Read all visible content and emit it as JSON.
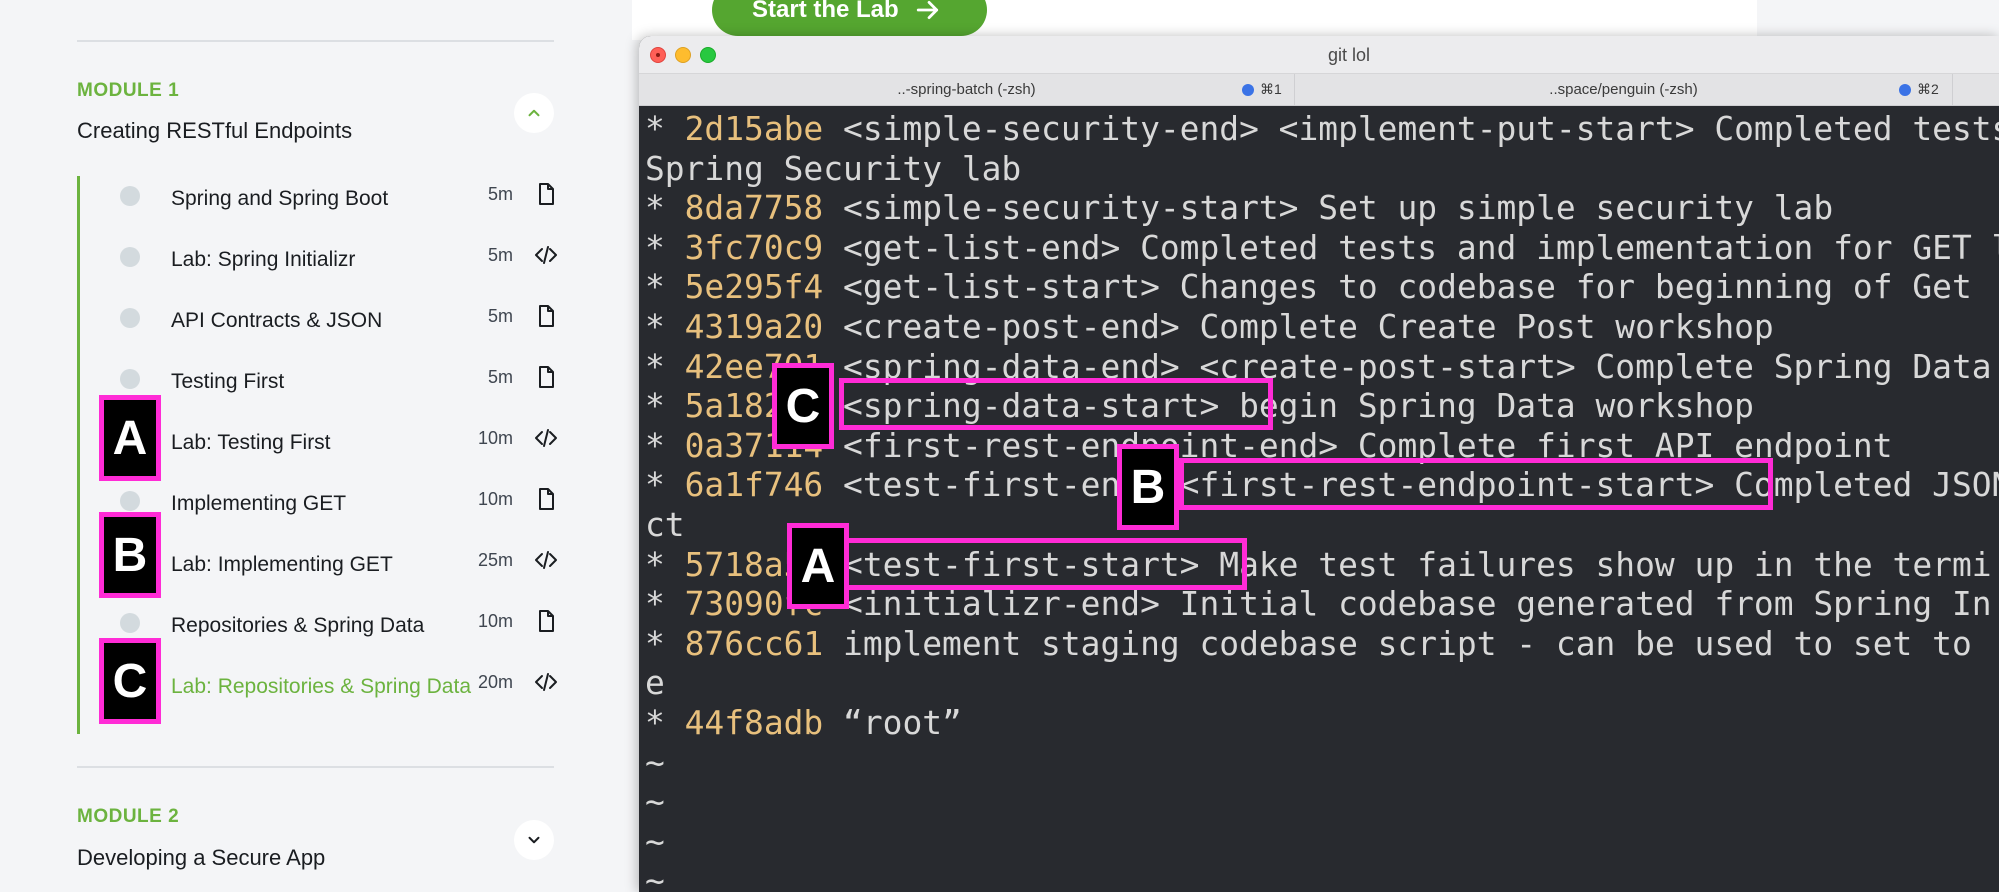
{
  "sidebar": {
    "module1": {
      "label": "MODULE 1",
      "title": "Creating RESTful Endpoints",
      "toggle_icon": "chevron-up-icon"
    },
    "lessons": [
      {
        "name": "Spring and Spring Boot",
        "duration": "5m",
        "icon": "document-icon"
      },
      {
        "name": "Lab: Spring Initializr",
        "duration": "5m",
        "icon": "code-icon"
      },
      {
        "name": "API Contracts & JSON",
        "duration": "5m",
        "icon": "document-icon"
      },
      {
        "name": "Testing First",
        "duration": "5m",
        "icon": "document-icon"
      },
      {
        "name": "Lab: Testing First",
        "duration": "10m",
        "icon": "code-icon"
      },
      {
        "name": "Implementing GET",
        "duration": "10m",
        "icon": "document-icon"
      },
      {
        "name": "Lab: Implementing GET",
        "duration": "25m",
        "icon": "code-icon"
      },
      {
        "name": "Repositories & Spring Data",
        "duration": "10m",
        "icon": "document-icon"
      },
      {
        "name": "Lab: Repositories & Spring Data",
        "duration": "20m",
        "icon": "code-icon"
      }
    ],
    "module2": {
      "label": "MODULE 2",
      "title": "Developing a Secure App",
      "toggle_icon": "chevron-down-icon"
    }
  },
  "page": {
    "start_button": "Start the Lab"
  },
  "terminal": {
    "title": "git lol",
    "tabs": [
      {
        "label": "..-spring-batch (-zsh)",
        "shortcut": "⌘1"
      },
      {
        "label": "..space/penguin (-zsh)",
        "shortcut": "⌘2"
      }
    ],
    "lines": [
      {
        "prefix": "* ",
        "hash": "2d15abe",
        "text": " <simple-security-end> <implement-put-start> Completed tests"
      },
      {
        "prefix": "",
        "hash": "",
        "text": "Spring Security lab"
      },
      {
        "prefix": "* ",
        "hash": "8da7758",
        "text": " <simple-security-start> Set up simple security lab"
      },
      {
        "prefix": "* ",
        "hash": "3fc70c9",
        "text": " <get-list-end> Completed tests and implementation for GET l"
      },
      {
        "prefix": "* ",
        "hash": "5e295f4",
        "text": " <get-list-start> Changes to codebase for beginning of Get"
      },
      {
        "prefix": "* ",
        "hash": "4319a20",
        "text": " <create-post-end> Complete Create Post workshop"
      },
      {
        "prefix": "* ",
        "hash": "42ee701",
        "text": " <spring-data-end> <create-post-start> Complete Spring Data"
      },
      {
        "prefix": "* ",
        "hash": "5a1820c",
        "text": " <spring-data-start> begin Spring Data workshop"
      },
      {
        "prefix": "* ",
        "hash": "0a37114",
        "text": " <first-rest-endpoint-end> Complete first API endpoint"
      },
      {
        "prefix": "* ",
        "hash": "6a1f746",
        "text": " <test-first-end> <first-rest-endpoint-start> Completed JSON"
      },
      {
        "prefix": "",
        "hash": "",
        "text": "ct"
      },
      {
        "prefix": "* ",
        "hash": "5718a5e",
        "text": " <test-first-start> Make test failures show up in the termi"
      },
      {
        "prefix": "* ",
        "hash": "73090fc",
        "text": " <initializr-end> Initial codebase generated from Spring In"
      },
      {
        "prefix": "* ",
        "hash": "876cc61",
        "text": " implement staging codebase script - can be used to set to"
      },
      {
        "prefix": "",
        "hash": "",
        "text": "e"
      },
      {
        "prefix": "* ",
        "hash": "44f8adb",
        "text": " “root”"
      },
      {
        "prefix": "",
        "hash": "",
        "text": "~"
      },
      {
        "prefix": "",
        "hash": "",
        "text": "~"
      },
      {
        "prefix": "",
        "hash": "",
        "text": "~"
      },
      {
        "prefix": "",
        "hash": "",
        "text": "~"
      }
    ]
  },
  "annotations": {
    "a": "A",
    "b": "B",
    "c": "C"
  },
  "colors": {
    "accent_green": "#6cb33f",
    "highlight_magenta": "#ff2bd6",
    "hash_yellow": "#e8c07d",
    "terminal_bg": "#282a2f"
  }
}
